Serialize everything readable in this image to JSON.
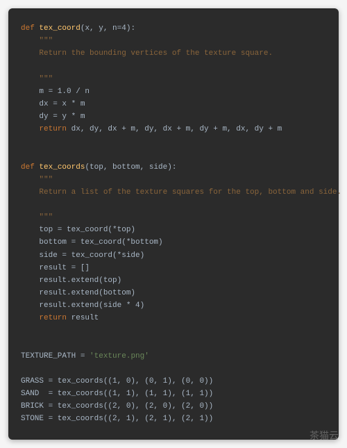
{
  "code": {
    "fn1": {
      "def": "def",
      "name": "tex_coord",
      "params": "(x, y, n=4):",
      "doc_open": "    \"\"\"",
      "doc_line": "    Return the bounding vertices of the texture square.",
      "doc_close": "    \"\"\"",
      "l1": "    m = 1.0 / n",
      "l2": "    dx = x * m",
      "l3": "    dy = y * m",
      "ret_kw": "    return",
      "ret_val": " dx, dy, dx + m, dy, dx + m, dy + m, dx, dy + m"
    },
    "fn2": {
      "def": "def",
      "name": "tex_coords",
      "params": "(top, bottom, side):",
      "doc_open": "    \"\"\"",
      "doc_line": "    Return a list of the texture squares for the top, bottom and side.",
      "doc_close": "    \"\"\"",
      "l1": "    top = tex_coord(*top)",
      "l2": "    bottom = tex_coord(*bottom)",
      "l3": "    side = tex_coord(*side)",
      "l4": "    result = []",
      "l5": "    result.extend(top)",
      "l6": "    result.extend(bottom)",
      "l7": "    result.extend(side * 4)",
      "ret_kw": "    return",
      "ret_val": " result"
    },
    "tex_path": {
      "name": "TEXTURE_PATH",
      "eq": " = ",
      "val": "'texture.png'"
    },
    "grass": "GRASS = tex_coords((1, 0), (0, 1), (0, 0))",
    "sand": "SAND  = tex_coords((1, 1), (1, 1), (1, 1))",
    "brick": "BRICK = tex_coords((2, 0), (2, 0), (2, 0))",
    "stone": "STONE = tex_coords((2, 1), (2, 1), (2, 1))"
  },
  "watermark": "茶猫云"
}
